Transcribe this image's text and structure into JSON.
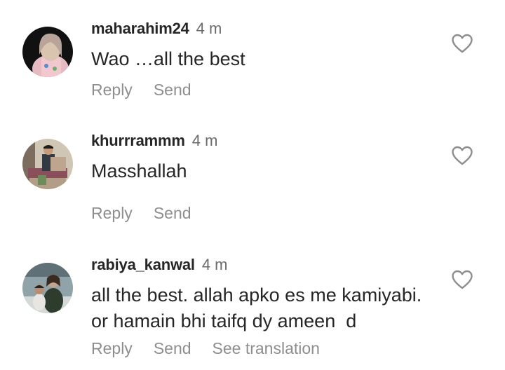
{
  "comments": [
    {
      "username": "maharahim24",
      "time": "4 m",
      "text": "Wao …all the best",
      "actions": {
        "reply": "Reply",
        "send": "Send"
      }
    },
    {
      "username": "khurrrammm",
      "time": "4 m",
      "text": "Masshallah",
      "actions": {
        "reply": "Reply",
        "send": "Send"
      }
    },
    {
      "username": "rabiya_kanwal",
      "time": "4 m",
      "text_lines": [
        "all the best. allah apko es me kamiyabi.",
        "or hamain bhi taifq dy ameen  d"
      ],
      "actions": {
        "reply": "Reply",
        "send": "Send",
        "translate": "See translation"
      }
    }
  ],
  "colors": {
    "text": "#262626",
    "secondary": "#8e8e8e",
    "time": "#6b6b6b"
  },
  "icons": {
    "like": "heart-outline-icon"
  }
}
